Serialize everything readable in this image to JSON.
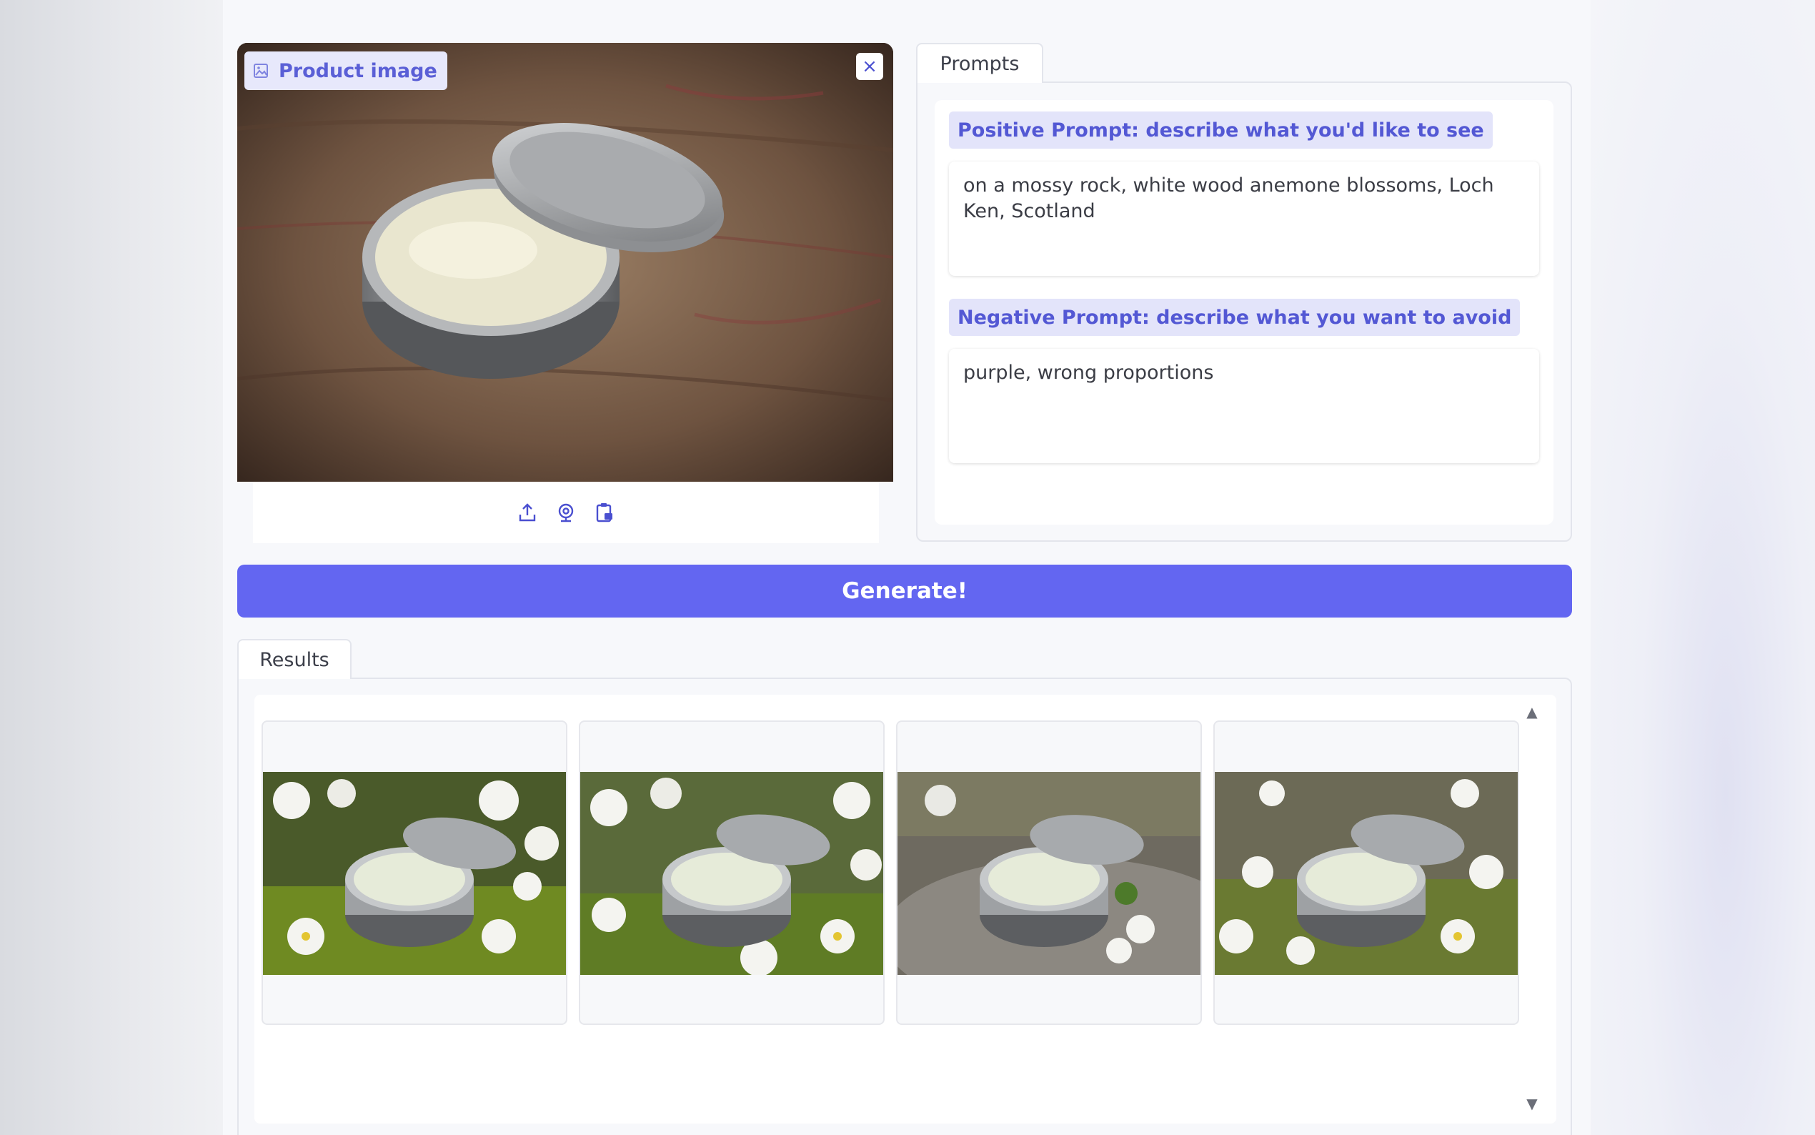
{
  "image_input": {
    "label": "Product image",
    "label_icon": "image-icon",
    "clear_icon": "close-icon",
    "clear_symbol": "×",
    "source_buttons": [
      "upload-icon",
      "webcam-icon",
      "clipboard-icon"
    ]
  },
  "prompts": {
    "tab_label": "Prompts",
    "positive": {
      "label": "Positive Prompt: describe what you'd like to see",
      "value": "on a mossy rock, white wood anemone blossoms, Loch Ken, Scotland"
    },
    "negative": {
      "label": "Negative Prompt: describe what you want to avoid",
      "value": "purple, wrong proportions"
    }
  },
  "generate": {
    "label": "Generate!"
  },
  "results": {
    "tab_label": "Results",
    "scroll_up_symbol": "▲",
    "scroll_down_symbol": "▼",
    "item_count": 4
  },
  "colors": {
    "accent": "#6366f1",
    "label_bg": "#e3e4fa",
    "label_text": "#5358d4"
  }
}
